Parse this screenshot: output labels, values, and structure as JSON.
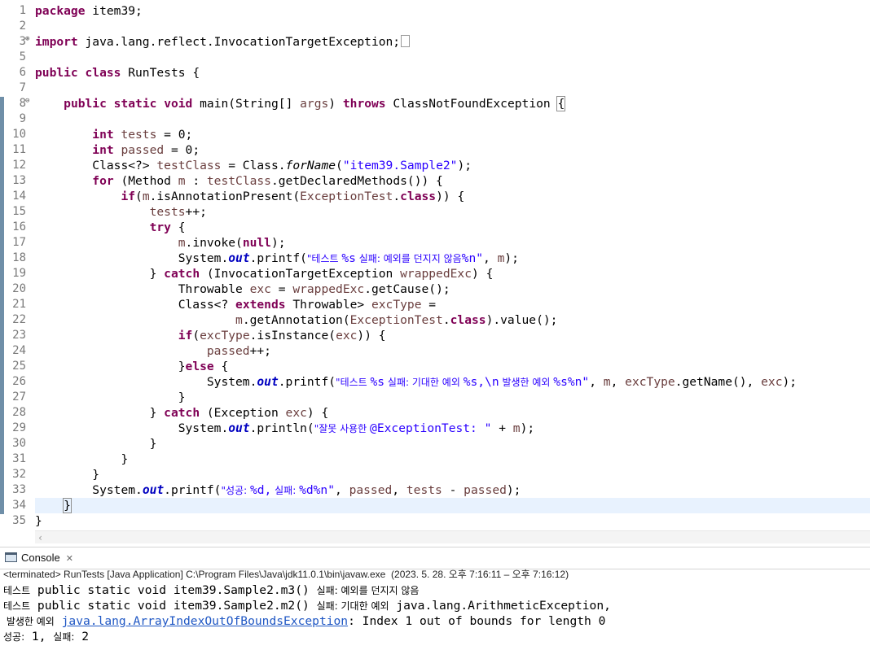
{
  "editor": {
    "line_numbers": [
      "1",
      "2",
      "3",
      "5",
      "6",
      "7",
      "8",
      "9",
      "10",
      "11",
      "12",
      "13",
      "14",
      "15",
      "16",
      "17",
      "18",
      "19",
      "20",
      "21",
      "22",
      "23",
      "24",
      "25",
      "26",
      "27",
      "28",
      "29",
      "30",
      "31",
      "32",
      "33",
      "34",
      "35"
    ],
    "line1": {
      "kw": "package",
      "rest": " item39;"
    },
    "line3": {
      "kw": "import",
      "rest": " java.lang.reflect.InvocationTargetException;"
    },
    "line6": {
      "kw1": "public",
      "kw2": "class",
      "rest": " RunTests {"
    },
    "line8": {
      "kw1": "public",
      "kw2": "static",
      "kw3": "void",
      "mid": " main(String[] ",
      "param": "args",
      "close": ") ",
      "kw4": "throws",
      "rest": " ClassNotFoundException ",
      "brace": "{"
    },
    "line10": {
      "kw": "int",
      "var": "tests",
      "rest": " = 0;"
    },
    "line11": {
      "kw": "int",
      "var": "passed",
      "rest": " = 0;"
    },
    "line12": {
      "a": "Class<?> ",
      "var": "testClass",
      "b": " = Class.",
      "method": "forName",
      "c": "(",
      "str": "\"item39.Sample2\"",
      "d": ");"
    },
    "line13": {
      "kw": "for",
      "a": " (Method ",
      "var1": "m",
      "b": " : ",
      "var2": "testClass",
      "c": ".getDeclaredMethods()) {"
    },
    "line14": {
      "kw": "if",
      "a": "(",
      "var": "m",
      "b": ".isAnnotationPresent(",
      "cls": "ExceptionTest",
      "c": ".",
      "kw2": "class",
      "d": ")) {"
    },
    "line15": {
      "var": "tests",
      "rest": "++;"
    },
    "line16": {
      "kw": "try",
      "rest": " {"
    },
    "line17": {
      "var": "m",
      "a": ".invoke(",
      "kw": "null",
      "b": ");"
    },
    "line18": {
      "a": "System.",
      "fld": "out",
      "b": ".printf(",
      "str_a": "\"테스트 ",
      "str_b": "%s",
      "str_c": " 실패: 예외를 던지지 않음",
      "str_d": "%n\"",
      "c": ", ",
      "var": "m",
      "d": ");"
    },
    "line19": {
      "a": "} ",
      "kw": "catch",
      "b": " (InvocationTargetException ",
      "var": "wrappedExc",
      "c": ") {"
    },
    "line20": {
      "a": "Throwable ",
      "var1": "exc",
      "b": " = ",
      "var2": "wrappedExc",
      "c": ".getCause();"
    },
    "line21": {
      "a": "Class<? ",
      "kw": "extends",
      "b": " Throwable> ",
      "var": "excType",
      "c": " ="
    },
    "line22": {
      "var": "m",
      "a": ".getAnnotation(",
      "cls": "ExceptionTest",
      "b": ".",
      "kw": "class",
      "c": ").value();"
    },
    "line23": {
      "kw": "if",
      "a": "(",
      "var1": "excType",
      "b": ".isInstance(",
      "var2": "exc",
      "c": ")) {"
    },
    "line24": {
      "var": "passed",
      "rest": "++;"
    },
    "line25": {
      "a": "}",
      "kw": "else",
      "b": " {"
    },
    "line26": {
      "a": "System.",
      "fld": "out",
      "b": ".printf(",
      "str_a": "\"테스트 ",
      "str_b": "%s",
      "str_c": " 실패: 기대한 예외 ",
      "str_d": "%s,\\n",
      "str_e": " 발생한 예외 ",
      "str_f": "%s%n\"",
      "c": ", ",
      "var1": "m",
      "d": ", ",
      "var2": "excType",
      "e": ".getName(), ",
      "var3": "exc",
      "f": ");"
    },
    "line27": "}",
    "line28": {
      "a": "} ",
      "kw": "catch",
      "b": " (Exception ",
      "var": "exc",
      "c": ") {"
    },
    "line29": {
      "a": "System.",
      "fld": "out",
      "b": ".println(",
      "str_a": "\"잘못 사용한 ",
      "str_b": "@ExceptionTest: \"",
      "c": " + ",
      "var": "m",
      "d": ");"
    },
    "line30": "}",
    "line31": "}",
    "line32": "}",
    "line33": {
      "a": "System.",
      "fld": "out",
      "b": ".printf(",
      "str_a": "\"성공: ",
      "str_b": "%d,",
      "str_c": " 실패: ",
      "str_d": "%d%n\"",
      "c": ", ",
      "var1": "passed",
      "d": ", ",
      "var2": "tests",
      "e": " - ",
      "var3": "passed",
      "f": ");"
    },
    "line34": "}",
    "line35": "}"
  },
  "console": {
    "tab_label": "Console",
    "status": "<terminated> RunTests [Java Application] C:\\Program Files\\Java\\jdk11.0.1\\bin\\javaw.exe  (2023. 5. 28. 오후 7:16:11 – 오후 7:16:12)",
    "out1": {
      "ko": "테스트",
      "a": " public static void item39.Sample2.m3() ",
      "ko2": "실패: 예외를 던지지 않음"
    },
    "out2": {
      "ko": "테스트",
      "a": " public static void item39.Sample2.m2() ",
      "ko2": "실패: 기대한 예외",
      "b": " java.lang.ArithmeticException,"
    },
    "out3": {
      "ko": " 발생한 예외",
      "link": "java.lang.ArrayIndexOutOfBoundsException",
      "b": ": Index 1 out of bounds for length 0"
    },
    "out4": {
      "ko": "성공:",
      "a": " 1, ",
      "ko2": "실패:",
      "b": " 2"
    }
  }
}
